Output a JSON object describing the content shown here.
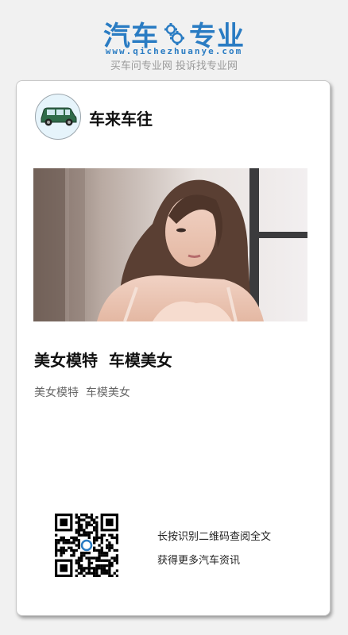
{
  "brand": {
    "name_left": "汽车",
    "name_right": "专业",
    "url": "www.qichezhuanye.com",
    "slogan": "买车问专业网 投诉找专业网",
    "color": "#2a7cc3"
  },
  "card": {
    "account_name": "车来车往",
    "avatar_icon": "car-icon",
    "article_title": "美女模特  车模美女",
    "article_summary": "美女模特  车模美女",
    "qr_line1": "长按识别二维码查阅全文",
    "qr_line2": "获得更多汽车资讯"
  }
}
